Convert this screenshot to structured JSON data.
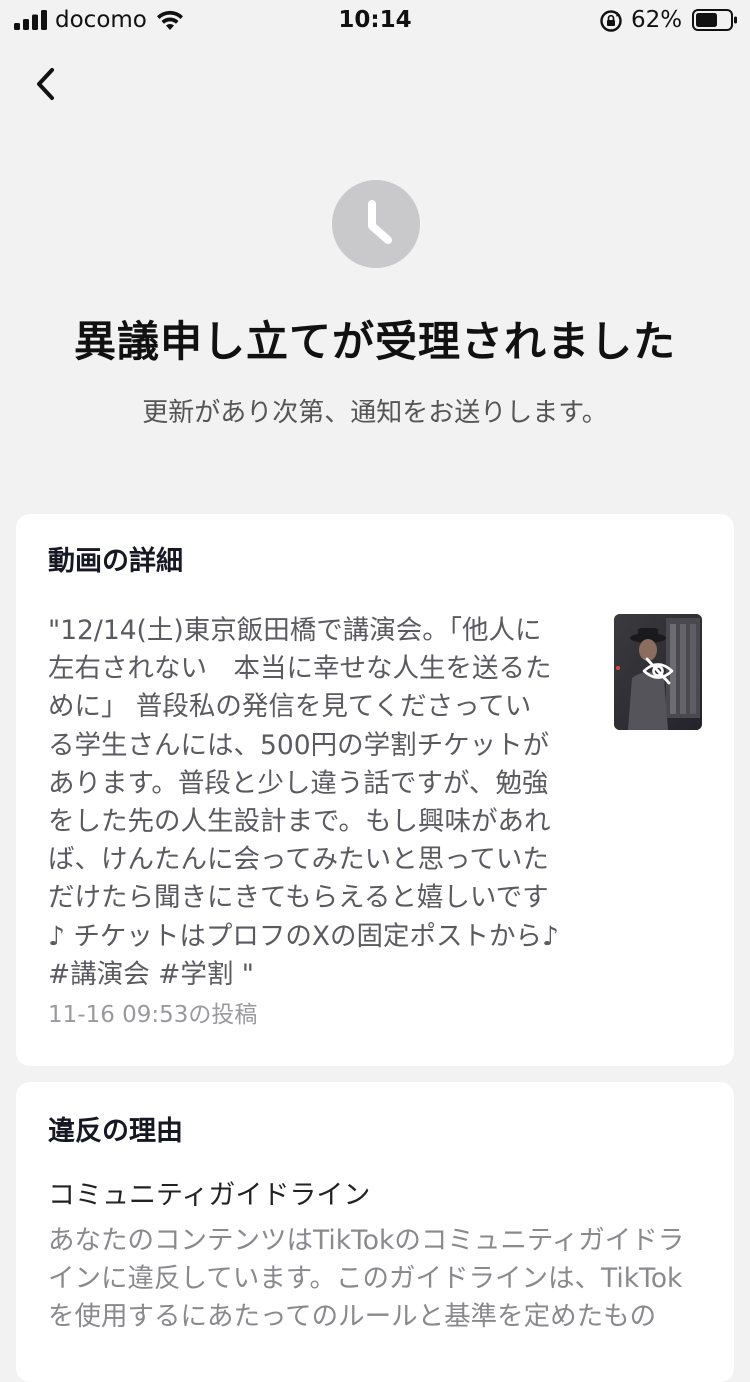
{
  "status_bar": {
    "carrier": "docomo",
    "time": "10:14",
    "battery_percent": "62%",
    "battery_level": 0.62
  },
  "header": {
    "back_icon": "chevron-left-icon"
  },
  "hero": {
    "icon": "clock-icon",
    "title": "異議申し立てが受理されました",
    "subtitle": "更新があり次第、通知をお送りします。"
  },
  "video_details": {
    "heading": "動画の詳細",
    "caption": "\"12/14(土)東京飯田橋で講演会。「他人に\n左右されない　本当に幸せな人生を送るた\nめに」 普段私の発信を見てくださってい\nる学生さんには、500円の学割チケットが\nあります。普段と少し違う話ですが、勉強\nをした先の人生設計まで。もし興味があれ\nば、けんたんに会ってみたいと思っていた\nだけたら聞きにきてもらえると嬉しいです\n♪ チケットはプロフのXの固定ポストから♪\n#講演会 #学割 \"",
    "posted_at": "11-16 09:53の投稿",
    "thumbnail_icon": "eye-off-icon"
  },
  "violation": {
    "heading": "違反の理由",
    "policy_name": "コミュニティガイドライン",
    "description": "あなたのコンテンツはTikTokのコミュニティガイドラ\nインに違反しています。このガイドラインは、TikTok\nを使用するにあたってのルールと基準を定めたもの"
  },
  "colors": {
    "background": "#f2f2f2",
    "card": "#ffffff",
    "icon_gray": "#c9c9cb",
    "title": "#111111",
    "secondary_text": "#5a5a60",
    "muted_text": "#9a9a9e"
  }
}
